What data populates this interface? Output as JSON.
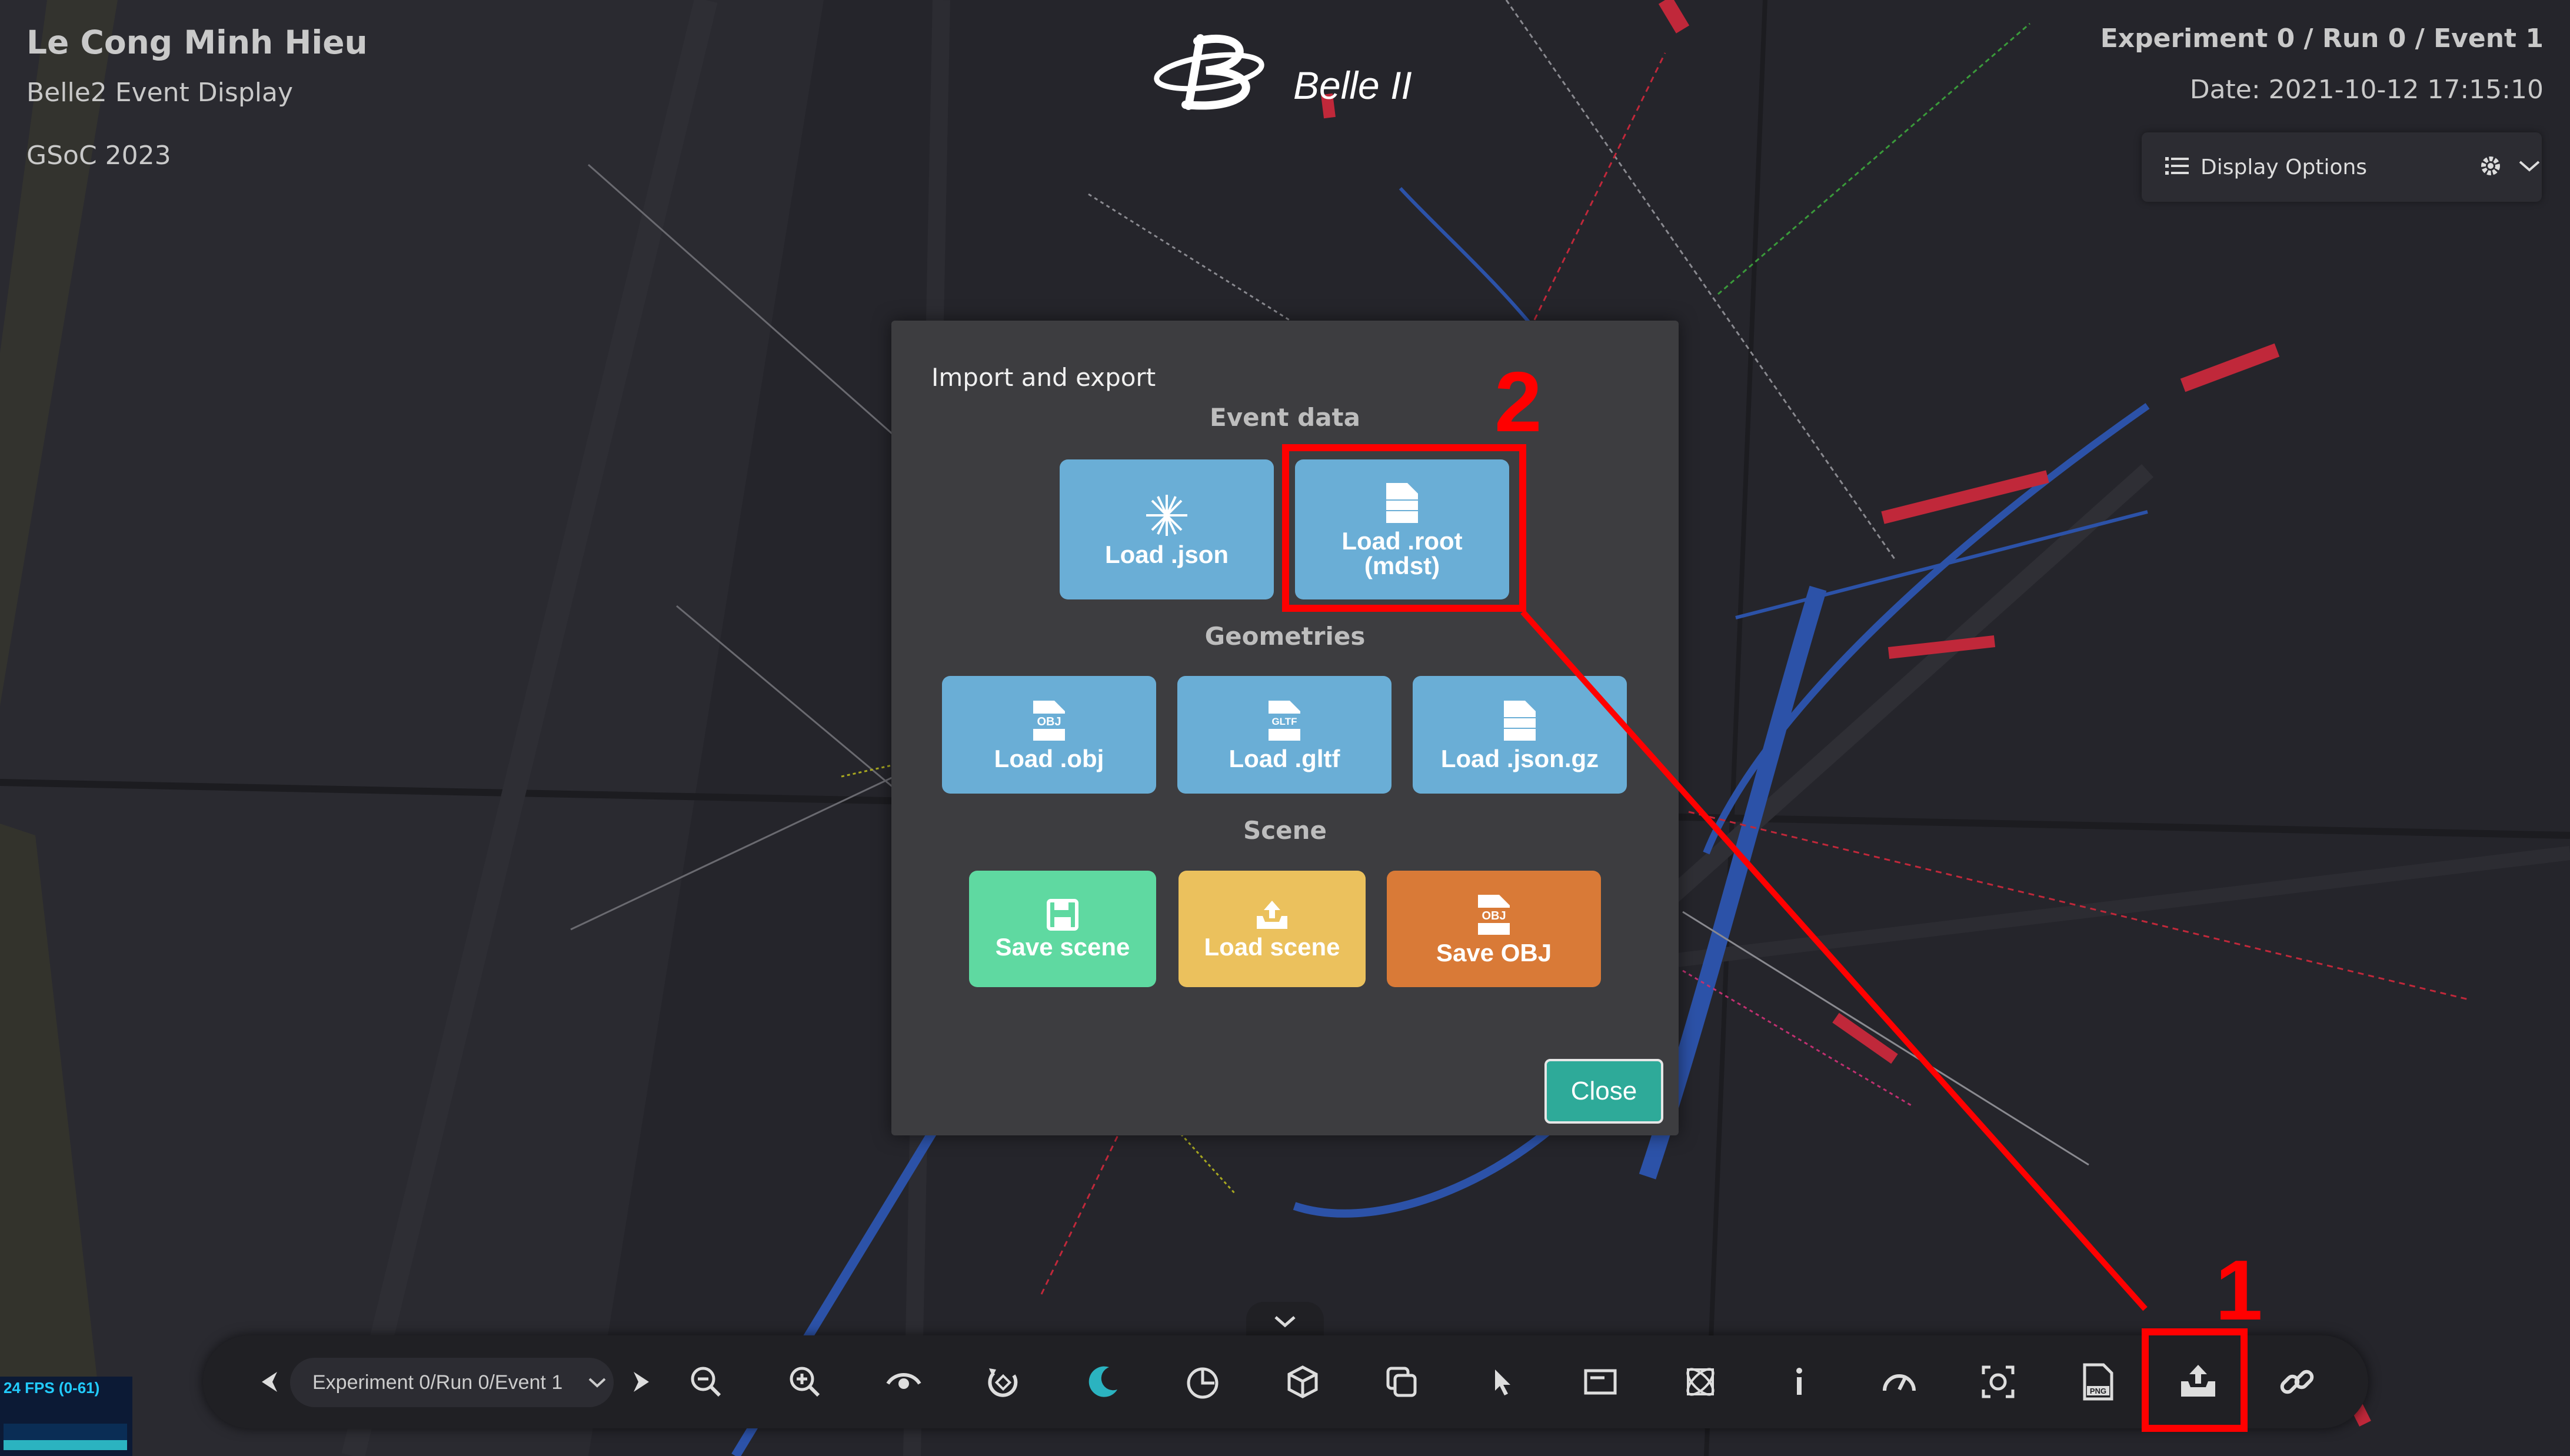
{
  "header": {
    "author": "Le Cong Minh Hieu",
    "subtitle": "Belle2 Event Display",
    "gsoc": "GSoC 2023",
    "logo_text": "Belle II",
    "experiment": "Experiment 0 / Run 0 / Event 1",
    "date": "Date: 2021-10-12 17:15:10"
  },
  "display_options": {
    "label": "Display Options",
    "icons": [
      "list-icon",
      "gear-icon",
      "chevron-down-icon"
    ]
  },
  "modal": {
    "title": "Import and export",
    "sections": {
      "event_data": "Event data",
      "geometries": "Geometries",
      "scene": "Scene"
    },
    "buttons": {
      "load_json": "Load .json",
      "load_root": "Load .root\n(mdst)",
      "load_obj": "Load .obj",
      "load_gltf": "Load .gltf",
      "load_jsongz": "Load .json.gz",
      "save_scene": "Save scene",
      "load_scene": "Load scene",
      "save_obj": "Save OBJ"
    },
    "close_label": "Close"
  },
  "toolbar": {
    "event_selector": "Experiment 0/Run 0/Event 1",
    "icons": [
      "prev-event-icon",
      "next-event-icon",
      "zoom-out-icon",
      "zoom-in-icon",
      "eye-icon",
      "rotate-icon",
      "dark-theme-icon",
      "overlay-icon",
      "cube-icon",
      "copy-icon",
      "select-icon",
      "info-panel-icon",
      "atom-icon",
      "info-icon",
      "speed-icon",
      "screenshot-icon",
      "png-icon",
      "import-export-icon",
      "link-icon"
    ]
  },
  "fps": {
    "label": "24 FPS (0-61)"
  },
  "annotations": {
    "one": "1",
    "two": "2"
  },
  "colors": {
    "accent_teal": "#2eaa99",
    "blue_button": "#6aaed6",
    "green_button": "#5fd9a1",
    "yellow_button": "#ebc15d",
    "orange_button": "#d97a37",
    "annotation_red": "#ff0000"
  }
}
